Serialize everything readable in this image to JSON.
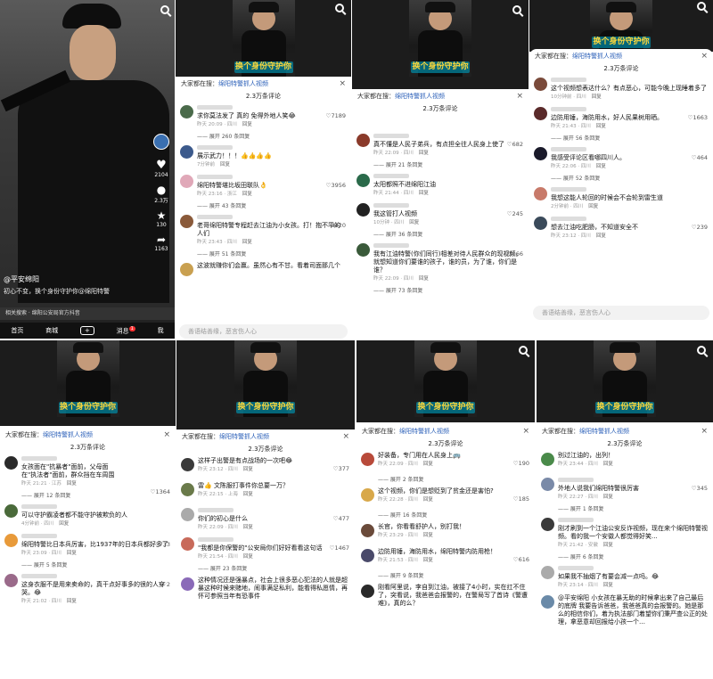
{
  "video_caption": "换个身份守护你",
  "main": {
    "username": "@平安绵阳",
    "caption": "初心不变，换个身份守护你@绵阳特警",
    "related": "相关搜索 · 绵阳公安局官方抖音",
    "likes": "2104",
    "comments": "2.3万",
    "favs": "130",
    "shares": "1163",
    "nav": [
      "首页",
      "商城",
      "+",
      "消息",
      "我"
    ],
    "msg_badge": "1"
  },
  "ui": {
    "banner_prefix": "大家都在搜：",
    "banner_query": "绵阳特警抓人视频",
    "close": "×",
    "count": "2.3万条评论",
    "input": "善语结善缘，恶言伤人心"
  },
  "panels": [
    {
      "comments": [
        {
          "text": "求你莫法发了 真的 免得外地人笑😂",
          "meta": "昨天 20:09 · 四川",
          "reply": "回复",
          "likes": "7189",
          "expand": "展开 260 条回复"
        },
        {
          "text": "展示武力！！！👍👍👍👍",
          "meta": "7分钟前",
          "reply": "回复",
          "likes": "",
          "expand": ""
        },
        {
          "text": "绵阳特警堪比坂田联队👌",
          "meta": "昨天 23:16 · 浙江",
          "reply": "回复",
          "likes": "3956",
          "expand": "展开 43 条回复"
        },
        {
          "text": "老哥绵阳特警专程赶去江油为小女孩。打！抱不平的人们",
          "meta": "昨天 23:43 · 四川",
          "reply": "回复",
          "likes": "3420",
          "expand": "展开 51 条回复"
        },
        {
          "text": "这波就赚你们会赢。虽然心有不甘。看着司面那几个",
          "meta": "",
          "reply": "",
          "likes": "",
          "expand": ""
        }
      ]
    },
    {
      "comments": [
        {
          "text": "真不懂是人民子弟兵，有点担全往人民身上使了",
          "meta": "昨天 22:09 · 四川",
          "reply": "回复",
          "likes": "682",
          "expand": "展开 21 条回复"
        },
        {
          "text": "太阳都照不进绵阳江油",
          "meta": "昨天 21:44 · 四川",
          "reply": "回复",
          "likes": "",
          "expand": ""
        },
        {
          "text": "我这管打人视频",
          "meta": "10分钟 · 四川",
          "reply": "回复",
          "likes": "245",
          "expand": "展开 36 条回复"
        },
        {
          "text": "我有江油特警(你们同行)相差对待人民群众的现视频。就想知道你们要谁的孩子，谁的员，为了谁，你们是谁？",
          "meta": "昨天 22:09 · 四川",
          "reply": "回复",
          "likes": "3066",
          "expand": "展开 73 条回复"
        }
      ]
    },
    {
      "comments": [
        {
          "text": "这个视频想表达什么？有点恶心，可能今晚上现睡着多了",
          "meta": "10分钟前 · 四川",
          "reply": "回复",
          "likes": "",
          "expand": ""
        },
        {
          "text": "边防用锤，海防用水，好人民果树用晒。",
          "meta": "昨天 21:43 · 四川",
          "reply": "回复",
          "likes": "1663",
          "expand": "展开 56 条回复"
        },
        {
          "text": "我感受评论区看哪四川人。",
          "meta": "昨天 22:06 · 四川",
          "reply": "回复",
          "likes": "464",
          "expand": "展开 52 条回复"
        },
        {
          "text": "我想这能人轮回的时候会不会轮到雷生道",
          "meta": "2分钟前 · 四川",
          "reply": "回复",
          "likes": "",
          "expand": ""
        },
        {
          "text": "想去江油吃肥肠，不知道安全不",
          "meta": "昨天 23:12 · 四川",
          "reply": "回复",
          "likes": "239",
          "expand": ""
        }
      ]
    },
    {
      "comments": [
        {
          "text": "女孩面在\"抗暴者\"面前，父母面在\"执法者\"面前，群众挡在车周围",
          "meta": "昨天 21:21 · 江苏",
          "reply": "回复",
          "likes": "1364",
          "expand": "展开 12 条回复"
        },
        {
          "text": "可以守护霸凌者都不能守护被欺负的人",
          "meta": "4分钟前 · 四川",
          "reply": "回复",
          "likes": "",
          "expand": ""
        },
        {
          "text": "绵阳特警比日本兵厉害，比1937年的日本兵都好多了",
          "meta": "昨天 23:09 · 四川",
          "reply": "回复",
          "likes": "733",
          "expand": "展开 5 条回复"
        },
        {
          "text": "这身衣服不是用来卖命的，真干点好事多的很的人穿哭。😂",
          "meta": "昨天 21:02 · 四川",
          "reply": "回复",
          "likes": "2",
          "expand": ""
        }
      ]
    },
    {
      "comments": [
        {
          "text": "这样子出警是有点战场的一次吧😂",
          "meta": "昨天 23:12 · 四川",
          "reply": "回复",
          "likes": "377",
          "expand": ""
        },
        {
          "text": "雷👍 文陈服打事件你总要一万？",
          "meta": "昨天 22:15 · 上海",
          "reply": "回复",
          "likes": "",
          "expand": ""
        },
        {
          "text": "你们的初心是什么",
          "meta": "昨天 22:09 · 四川",
          "reply": "回复",
          "likes": "477",
          "expand": ""
        },
        {
          "text": "\"我都是你保警的\"公安局你们好好看看这句话",
          "meta": "昨天 21:54 · 四川",
          "reply": "回复",
          "likes": "1467",
          "expand": "展开 23 条回复"
        },
        {
          "text": "这种情况还是强暴点，社会上很多恶心犯法的人就是超暴这种时候来赌地，闹事满足私利，能看得私愿情，再怀可参照当年有恐事件",
          "meta": "",
          "reply": "",
          "likes": "",
          "expand": ""
        }
      ]
    },
    {
      "comments": [
        {
          "text": "好装备，专门用在人民身上🚌",
          "meta": "昨天 22:09 · 四川",
          "reply": "回复",
          "likes": "190",
          "expand": "展开 2 条回复"
        },
        {
          "text": "这个视频，你们是想贬到了贫金还是害怕?",
          "meta": "昨天 22:28 · 四川",
          "reply": "回复",
          "likes": "185",
          "expand": "展开 16 条回复"
        },
        {
          "text": "长官，你看看舒护人，别打我！",
          "meta": "昨天 23:29 · 四川",
          "reply": "回复",
          "likes": "",
          "expand": ""
        },
        {
          "text": "边防用锤，海防用水，绵阳特警内防用枪！",
          "meta": "昨天 21:53 · 四川",
          "reply": "回复",
          "likes": "616",
          "expand": "展开 9 条回复"
        },
        {
          "text": "刚看阿里说，李自到江油，被接了4小时，实在扛不住了，突看说，我爸爸会报警的，在警局写了首诗《警遭难》，真的么？",
          "meta": "",
          "reply": "",
          "likes": "",
          "expand": ""
        }
      ]
    },
    {
      "comments": [
        {
          "text": "别过江油的，出列！",
          "meta": "昨天 23:44 · 四川",
          "reply": "回复",
          "likes": "",
          "expand": ""
        },
        {
          "text": "外地人说我们绵阳特警很厉害",
          "meta": "昨天 22:27 · 四川",
          "reply": "回复",
          "likes": "345",
          "expand": "展开 1 条回复"
        },
        {
          "text": "刚才刷到一个江油公安反诈视频，现在来个绵阳特警视频。看的我一个安徽人都觉得好笑...",
          "meta": "昨天 21:42 · 安徽",
          "reply": "回复",
          "likes": "",
          "expand": "展开 6 条回复"
        },
        {
          "text": "如果我不抽烟了有要会减一点吗。😂",
          "meta": "昨天 23:14 · 四川",
          "reply": "回复",
          "likes": "",
          "expand": ""
        },
        {
          "text": "@平安绵阳 小女孩在暴无助的时候拿出来了自己最后的底牌 我要告诉爸爸，我爸爸真的会报警的。她是那么的相信你们，着为执法部门着望你们秉严查公正的处理，拿恶意却回报给小孩一个…",
          "meta": "",
          "reply": "",
          "likes": "",
          "expand": ""
        }
      ]
    }
  ]
}
